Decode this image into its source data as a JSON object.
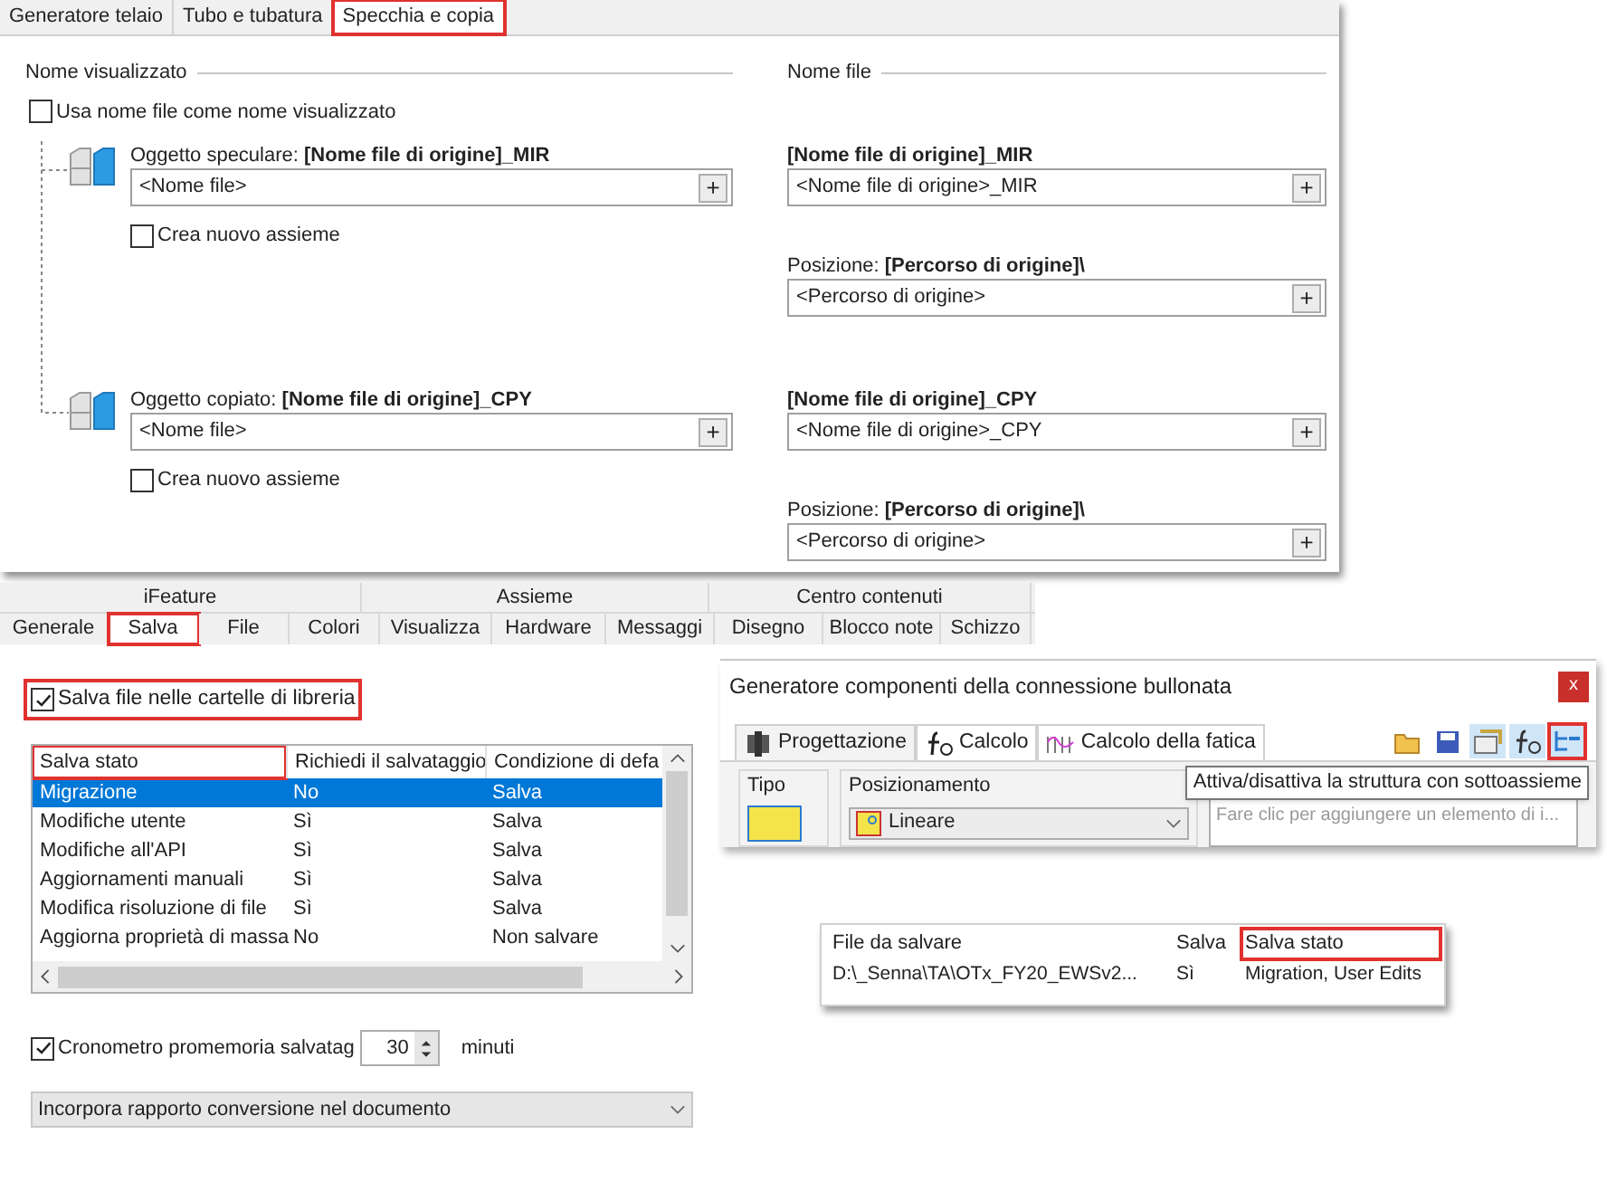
{
  "mirror_panel": {
    "tabs": [
      {
        "label": "Generatore telaio",
        "selected": false,
        "highlighted": false
      },
      {
        "label": "Tubo e tubatura",
        "selected": false,
        "highlighted": false
      },
      {
        "label": "Specchia e copia",
        "selected": true,
        "highlighted": true
      }
    ],
    "display_name_heading": "Nome visualizzato",
    "file_name_heading": "Nome file",
    "use_file_name": {
      "label": "Usa nome file come nome visualizzato",
      "checked": false
    },
    "objects": [
      {
        "label": "Oggetto speculare: **[Nome file di origine]_MIR**",
        "value": "<Nome file>",
        "button": "+",
        "new_assembly": {
          "label": "Crea nuovo assieme",
          "checked": false
        },
        "file_label": "[Nome file di origine]_MIR",
        "file_value": "<Nome file di origine>_MIR",
        "file_button": "+",
        "position_label": "Posizione: **[Percorso di origine]\\**",
        "position_value": "<Percorso di origine>",
        "position_button": "+"
      },
      {
        "label": "Oggetto copiato: **[Nome file di origine]_CPY**",
        "value": "<Nome file>",
        "button": "+",
        "new_assembly": {
          "label": "Crea nuovo assieme",
          "checked": false
        },
        "file_label": "[Nome file di origine]_CPY",
        "file_value": "<Nome file di origine>_CPY",
        "file_button": "+",
        "position_label": "Posizione: **[Percorso di origine]\\**",
        "position_value": "<Percorso di origine>",
        "position_button": "+"
      }
    ]
  },
  "options_panel": {
    "group_tabs": [
      "iFeature",
      "Assieme",
      "Centro contenuti"
    ],
    "tabs": [
      {
        "label": "Generale",
        "selected": false,
        "highlighted": false
      },
      {
        "label": "Salva",
        "selected": true,
        "highlighted": true
      },
      {
        "label": "File",
        "selected": false,
        "highlighted": false
      },
      {
        "label": "Colori",
        "selected": false,
        "highlighted": false
      },
      {
        "label": "Visualizza",
        "selected": false,
        "highlighted": false
      },
      {
        "label": "Hardware",
        "selected": false,
        "highlighted": false
      },
      {
        "label": "Messaggi",
        "selected": false,
        "highlighted": false
      },
      {
        "label": "Disegno",
        "selected": false,
        "highlighted": false
      },
      {
        "label": "Blocco note",
        "selected": false,
        "highlighted": false
      },
      {
        "label": "Schizzo",
        "selected": false,
        "highlighted": false
      }
    ],
    "library_checkbox": {
      "label": "Salva file nelle cartelle di libreria",
      "checked": true,
      "highlighted": true
    },
    "table": {
      "columns": [
        {
          "label": "Salva stato",
          "highlighted": true
        },
        {
          "label": "Richiedi il salvataggio",
          "highlighted": false
        },
        {
          "label": "Condizione di defa",
          "highlighted": false
        }
      ],
      "rows": [
        {
          "cells": [
            "Migrazione",
            "No",
            "Salva"
          ],
          "selected": true
        },
        {
          "cells": [
            "Modifiche utente",
            "Sì",
            "Salva"
          ],
          "selected": false
        },
        {
          "cells": [
            "Modifiche all'API",
            "Sì",
            "Salva"
          ],
          "selected": false
        },
        {
          "cells": [
            "Aggiornamenti manuali",
            "Sì",
            "Salva"
          ],
          "selected": false
        },
        {
          "cells": [
            "Modifica risoluzione di file",
            "Sì",
            "Salva"
          ],
          "selected": false
        },
        {
          "cells": [
            "Aggiorna proprietà di massa",
            "No",
            "Non salvare"
          ],
          "selected": false
        }
      ]
    },
    "reminder": {
      "label": "Cronometro promemoria salvatag",
      "checked": true,
      "value": "30",
      "unit": "minuti"
    },
    "conversion_dropdown": {
      "value": "Incorpora rapporto conversione nel documento"
    }
  },
  "bolt_dialog": {
    "title": "Generatore componenti della connessione bullonata",
    "close": "x",
    "tabs": [
      {
        "label": "Progettazione",
        "selected": true
      },
      {
        "label": "Calcolo",
        "selected": false
      },
      {
        "label": "Calcolo della fatica",
        "selected": false
      }
    ],
    "toolbar": [
      {
        "kind": "open",
        "highlighted": false
      },
      {
        "kind": "save",
        "highlighted": false
      },
      {
        "kind": "properties",
        "highlighted": false
      },
      {
        "kind": "calc",
        "highlighted": false
      },
      {
        "kind": "structure",
        "highlighted": true
      }
    ],
    "tooltip": "Attiva/disattiva la struttura con sottoassieme",
    "type_group": "Tipo",
    "placement_group": "Posizionamento",
    "placement_value": "Lineare",
    "list_placeholder": "Fare clic per aggiungere un elemento di i..."
  },
  "save_panel": {
    "columns": [
      {
        "label": "File da salvare",
        "highlighted": false
      },
      {
        "label": "Salva",
        "highlighted": false
      },
      {
        "label": "Salva stato",
        "highlighted": true
      }
    ],
    "rows": [
      {
        "cells": [
          "D:\\_Senna\\TA\\OTx_FY20_EWSv2...",
          "Sì",
          "Migration, User Edits"
        ]
      }
    ]
  }
}
